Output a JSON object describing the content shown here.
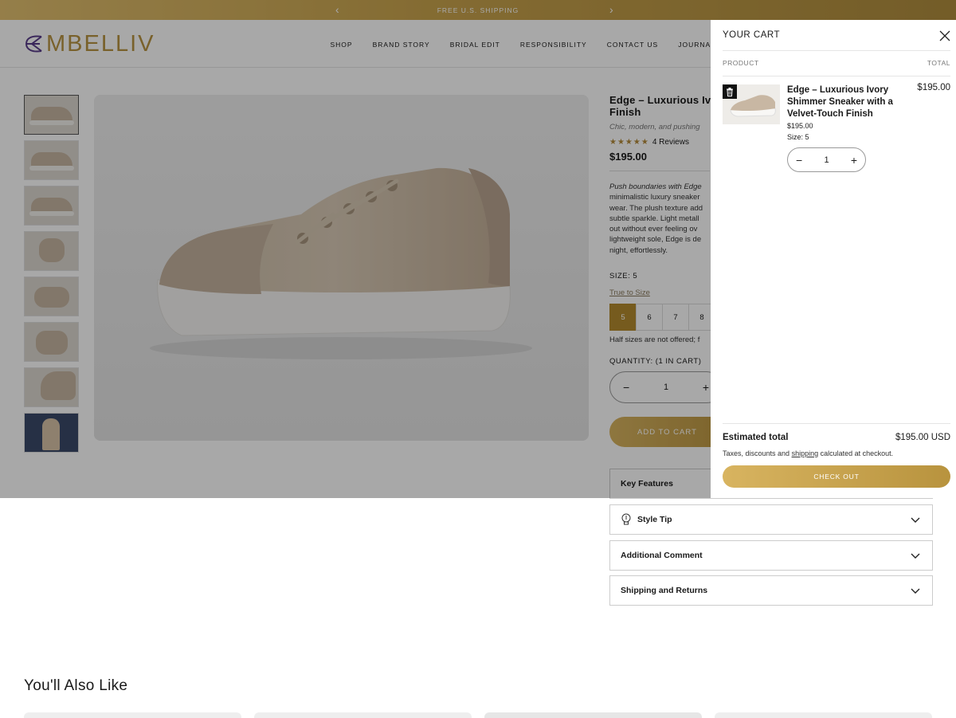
{
  "announcement": {
    "text": "FREE U.S. SHIPPING",
    "prev_icon": "chevron-left-icon",
    "next_icon": "chevron-right-icon"
  },
  "header": {
    "logo_text": "MBELLIV",
    "nav": [
      "SHOP",
      "BRAND STORY",
      "BRIDAL EDIT",
      "RESPONSIBILITY",
      "CONTACT US",
      "JOURNAL"
    ]
  },
  "product": {
    "title": "Edge – Luxurious Ivo",
    "title_line2": "Finish",
    "subtitle": "Chic, modern, and pushing",
    "rating_stars": 5,
    "reviews": "4 Reviews",
    "price": "$195.00",
    "description_italic": "Push boundaries with Edge",
    "description_lines": [
      "minimalistic luxury sneaker",
      "wear. The plush texture add",
      "subtle sparkle. Light metall",
      "out without ever feeling ov",
      "lightweight sole, Edge is de",
      "night, effortlessly."
    ],
    "size_label": "SIZE: 5",
    "true_to_size": "True to Size",
    "sizes": [
      "5",
      "6",
      "7",
      "8"
    ],
    "selected_size": "5",
    "half_sizes_note": "Half sizes are not offered; f",
    "quantity_label": "QUANTITY: (1 IN CART)",
    "quantity": "1",
    "add_to_cart": "ADD TO CART"
  },
  "accordions": {
    "key_features": "Key Features",
    "style_tip": "Style Tip",
    "additional_comment": "Additional Comment",
    "shipping_returns": "Shipping and Returns"
  },
  "also_like": {
    "heading": "You'll Also Like"
  },
  "cart": {
    "title": "YOUR CART",
    "col_product": "PRODUCT",
    "col_total": "TOTAL",
    "item": {
      "name": "Edge – Luxurious Ivory Shimmer Sneaker with a Velvet-Touch Finish",
      "line_total": "$195.00",
      "unit_price": "$195.00",
      "size": "Size: 5",
      "quantity": "1"
    },
    "estimated_label": "Estimated total",
    "estimated_value": "$195.00 USD",
    "tax_before": "Taxes, discounts and ",
    "tax_link": "shipping",
    "tax_after": " calculated at checkout.",
    "checkout": "CHECK OUT"
  },
  "colors": {
    "gold": "#b89442",
    "gold_button": "#c9a44d",
    "selected_size": "#b48b2e"
  }
}
